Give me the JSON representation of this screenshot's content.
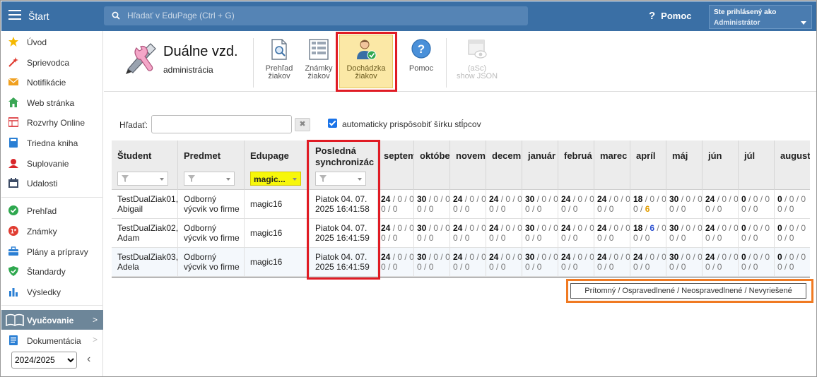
{
  "topbar": {
    "app_title": "Štart",
    "search_placeholder": "Hľadať v EduPage (Ctrl + G)",
    "help_label": "Pomoc",
    "help_glyph": "?",
    "user_line1": "Ste prihlásený ako",
    "user_line2": "Administrátor"
  },
  "sidebar": {
    "items": [
      {
        "label": "Úvod",
        "icon": "star-icon",
        "color": "#f5b800"
      },
      {
        "label": "Sprievodca",
        "icon": "wand-icon",
        "color": "#e03c31"
      },
      {
        "label": "Notifikácie",
        "icon": "envelope-icon",
        "color": "#f0a020"
      },
      {
        "label": "Web stránka",
        "icon": "house-icon",
        "color": "#3aa655"
      },
      {
        "label": "Rozvrhy Online",
        "icon": "timetable-icon",
        "color": "#d9262a"
      },
      {
        "label": "Triedna kniha",
        "icon": "book-icon",
        "color": "#2a7fd4"
      },
      {
        "label": "Suplovanie",
        "icon": "person-icon",
        "color": "#d9262a"
      },
      {
        "label": "Udalosti",
        "icon": "calendar-icon",
        "color": "#3d4c66"
      },
      {
        "label": "Prehľad",
        "icon": "check-circle-icon",
        "color": "#2fa84f"
      },
      {
        "label": "Známky",
        "icon": "grades-icon",
        "color": "#e03c31"
      },
      {
        "label": "Plány a prípravy",
        "icon": "briefcase-icon",
        "color": "#2a7fd4"
      },
      {
        "label": "Štandardy",
        "icon": "shield-icon",
        "color": "#2fa84f"
      },
      {
        "label": "Výsledky",
        "icon": "bar-chart-icon",
        "color": "#2a7fd4"
      }
    ],
    "section_label": "Vyučovanie",
    "dokumentacia_label": "Dokumentácia",
    "year_value": "2024/2025",
    "year_options": [
      "2024/2025"
    ]
  },
  "module": {
    "title": "Duálne vzd.",
    "subtitle": "administrácia",
    "toolbar": [
      {
        "l1": "Prehľad",
        "l2": "žiakov",
        "icon": "document-search-icon"
      },
      {
        "l1": "Známky",
        "l2": "žiakov",
        "icon": "grades-grid-icon"
      },
      {
        "l1": "Dochádzka",
        "l2": "žiakov",
        "icon": "attendance-person-icon"
      },
      {
        "l1": "Pomoc",
        "l2": "",
        "icon": "help-icon"
      },
      {
        "l1": "(aSc)",
        "l2": "show JSON",
        "icon": "json-view-icon"
      }
    ]
  },
  "filters": {
    "search_label": "Hľadať:",
    "search_value": "",
    "clear_glyph": "✖",
    "auto_width_label": "automaticky prispôsobiť šírku stĺpcov",
    "auto_width_checked": true
  },
  "grid": {
    "columns": {
      "student": "Študent",
      "predmet": "Predmet",
      "edupage": "Edupage",
      "sync_l1": "Posledná",
      "sync_l2": "synchronizác",
      "months": [
        "septem",
        "októbe",
        "novem",
        "decem",
        "január",
        "februá",
        "marec",
        "apríl",
        "máj",
        "jún",
        "júl",
        "august"
      ]
    },
    "edupage_filter_value": "magic...",
    "rows": [
      {
        "student_l1": "TestDualZiak01,",
        "student_l2": "Abigail",
        "predmet_l1": "Odborný",
        "predmet_l2": "výcvik vo firme",
        "edupage": "magic16",
        "sync_l1": "Piatok 04. 07.",
        "sync_l2": "2025 16:41:58",
        "months": [
          {
            "p": "24",
            "o": "0",
            "n": "0",
            "u": "0",
            "v": "0"
          },
          {
            "p": "30",
            "o": "0",
            "n": "0",
            "u": "0",
            "v": "0"
          },
          {
            "p": "24",
            "o": "0",
            "n": "0",
            "u": "0",
            "v": "0"
          },
          {
            "p": "24",
            "o": "0",
            "n": "0",
            "u": "0",
            "v": "0"
          },
          {
            "p": "30",
            "o": "0",
            "n": "0",
            "u": "0",
            "v": "0"
          },
          {
            "p": "24",
            "o": "0",
            "n": "0",
            "u": "0",
            "v": "0"
          },
          {
            "p": "24",
            "o": "0",
            "n": "0",
            "u": "0",
            "v": "0"
          },
          {
            "p": "18",
            "o": "0",
            "n": "0",
            "u": "0",
            "v": "6",
            "flag": "u"
          },
          {
            "p": "30",
            "o": "0",
            "n": "0",
            "u": "0",
            "v": "0"
          },
          {
            "p": "24",
            "o": "0",
            "n": "0",
            "u": "0",
            "v": "0"
          },
          {
            "p": "0",
            "o": "0",
            "n": "0",
            "u": "0",
            "v": "0"
          },
          {
            "p": "0",
            "o": "0",
            "n": "0",
            "u": "0",
            "v": "0"
          }
        ]
      },
      {
        "student_l1": "TestDualZiak02,",
        "student_l2": "Adam",
        "predmet_l1": "Odborný",
        "predmet_l2": "výcvik vo firme",
        "edupage": "magic16",
        "sync_l1": "Piatok 04. 07.",
        "sync_l2": "2025 16:41:59",
        "months": [
          {
            "p": "24",
            "o": "0",
            "n": "0",
            "u": "0",
            "v": "0"
          },
          {
            "p": "30",
            "o": "0",
            "n": "0",
            "u": "0",
            "v": "0"
          },
          {
            "p": "24",
            "o": "0",
            "n": "0",
            "u": "0",
            "v": "0"
          },
          {
            "p": "24",
            "o": "0",
            "n": "0",
            "u": "0",
            "v": "0"
          },
          {
            "p": "30",
            "o": "0",
            "n": "0",
            "u": "0",
            "v": "0"
          },
          {
            "p": "24",
            "o": "0",
            "n": "0",
            "u": "0",
            "v": "0"
          },
          {
            "p": "24",
            "o": "0",
            "n": "0",
            "u": "0",
            "v": "0"
          },
          {
            "p": "18",
            "o": "6",
            "n": "0",
            "u": "0",
            "v": "0",
            "flag": "o"
          },
          {
            "p": "30",
            "o": "0",
            "n": "0",
            "u": "0",
            "v": "0"
          },
          {
            "p": "24",
            "o": "0",
            "n": "0",
            "u": "0",
            "v": "0"
          },
          {
            "p": "0",
            "o": "0",
            "n": "0",
            "u": "0",
            "v": "0"
          },
          {
            "p": "0",
            "o": "0",
            "n": "0",
            "u": "0",
            "v": "0"
          }
        ]
      },
      {
        "student_l1": "TestDualZiak03,",
        "student_l2": "Adela",
        "predmet_l1": "Odborný",
        "predmet_l2": "výcvik vo firme",
        "edupage": "magic16",
        "sync_l1": "Piatok 04. 07.",
        "sync_l2": "2025 16:41:59",
        "months": [
          {
            "p": "24",
            "o": "0",
            "n": "0",
            "u": "0",
            "v": "0"
          },
          {
            "p": "30",
            "o": "0",
            "n": "0",
            "u": "0",
            "v": "0"
          },
          {
            "p": "24",
            "o": "0",
            "n": "0",
            "u": "0",
            "v": "0"
          },
          {
            "p": "24",
            "o": "0",
            "n": "0",
            "u": "0",
            "v": "0"
          },
          {
            "p": "30",
            "o": "0",
            "n": "0",
            "u": "0",
            "v": "0"
          },
          {
            "p": "24",
            "o": "0",
            "n": "0",
            "u": "0",
            "v": "0"
          },
          {
            "p": "24",
            "o": "0",
            "n": "0",
            "u": "0",
            "v": "0"
          },
          {
            "p": "24",
            "o": "0",
            "n": "0",
            "u": "0",
            "v": "0"
          },
          {
            "p": "30",
            "o": "0",
            "n": "0",
            "u": "0",
            "v": "0"
          },
          {
            "p": "24",
            "o": "0",
            "n": "0",
            "u": "0",
            "v": "0"
          },
          {
            "p": "0",
            "o": "0",
            "n": "0",
            "u": "0",
            "v": "0"
          },
          {
            "p": "0",
            "o": "0",
            "n": "0",
            "u": "0",
            "v": "0"
          }
        ]
      }
    ]
  },
  "legend": "Prítomný / Ospravedlnené / Neospravedlnené / Nevyriešené",
  "colors": {
    "topbar": "#3a6fa5",
    "active_tool": "#fbe8a6",
    "highlight_red": "#e01b24",
    "highlight_orange": "#f07a22",
    "excused_blue": "#2a4fd0",
    "unresolved_orange": "#e39d00"
  }
}
